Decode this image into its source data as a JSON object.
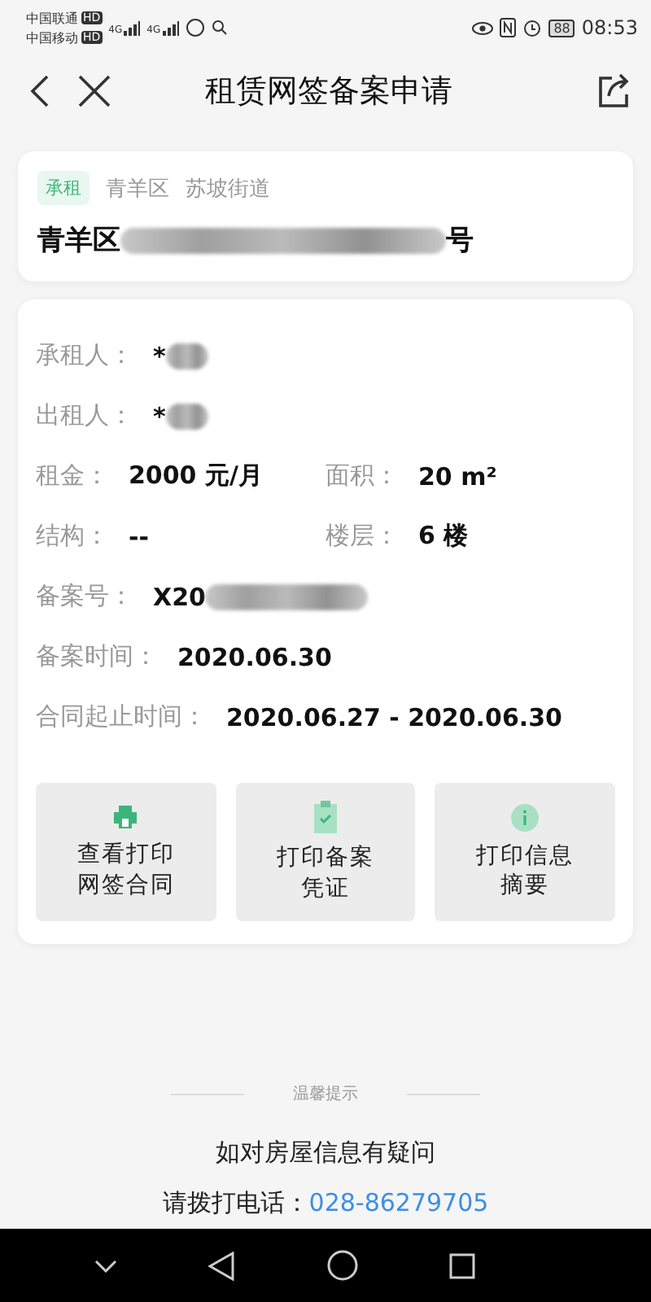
{
  "status_bar": {
    "carriers": [
      {
        "name": "中国联通",
        "badge": "HD"
      },
      {
        "name": "中国移动",
        "badge": "HD"
      }
    ],
    "network_labels": [
      "4G",
      "4G"
    ],
    "battery": "88",
    "time": "08:53"
  },
  "header": {
    "title": "租赁网签备案申请"
  },
  "address_card": {
    "tag": "承租",
    "district": "青羊区",
    "street": "苏坡街道",
    "address_start": "青羊区",
    "address_redacted": true,
    "address_end": "号"
  },
  "details": [
    [
      {
        "label": "承租人：",
        "value": "*",
        "redacted": true
      }
    ],
    [
      {
        "label": "出租人：",
        "value": "*",
        "redacted": true
      }
    ],
    [
      {
        "label": "租金：",
        "value": "2000 元/月",
        "redacted": false
      },
      {
        "label": "面积：",
        "value": "20 m²",
        "redacted": false
      }
    ],
    [
      {
        "label": "结构：",
        "value": "--",
        "redacted": false
      },
      {
        "label": "楼层：",
        "value": "6 楼",
        "redacted": false
      }
    ],
    [
      {
        "label": "备案号：",
        "value": "X20",
        "redacted": true
      }
    ],
    [
      {
        "label": "备案时间：",
        "value": "2020.06.30",
        "redacted": false
      }
    ],
    [
      {
        "label": "合同起止时间：",
        "value": "2020.06.27 - 2020.06.30",
        "redacted": false
      }
    ]
  ],
  "actions": [
    {
      "kind": "printer",
      "label": "查看打印网签合同"
    },
    {
      "kind": "clipboard",
      "label": "打印备案凭证"
    },
    {
      "kind": "info",
      "label": "打印信息摘要"
    }
  ],
  "tips": {
    "heading": "温馨提示",
    "line": "如对房屋信息有疑问",
    "phone_label": "请拨打电话：",
    "phone": "028-86279705"
  }
}
